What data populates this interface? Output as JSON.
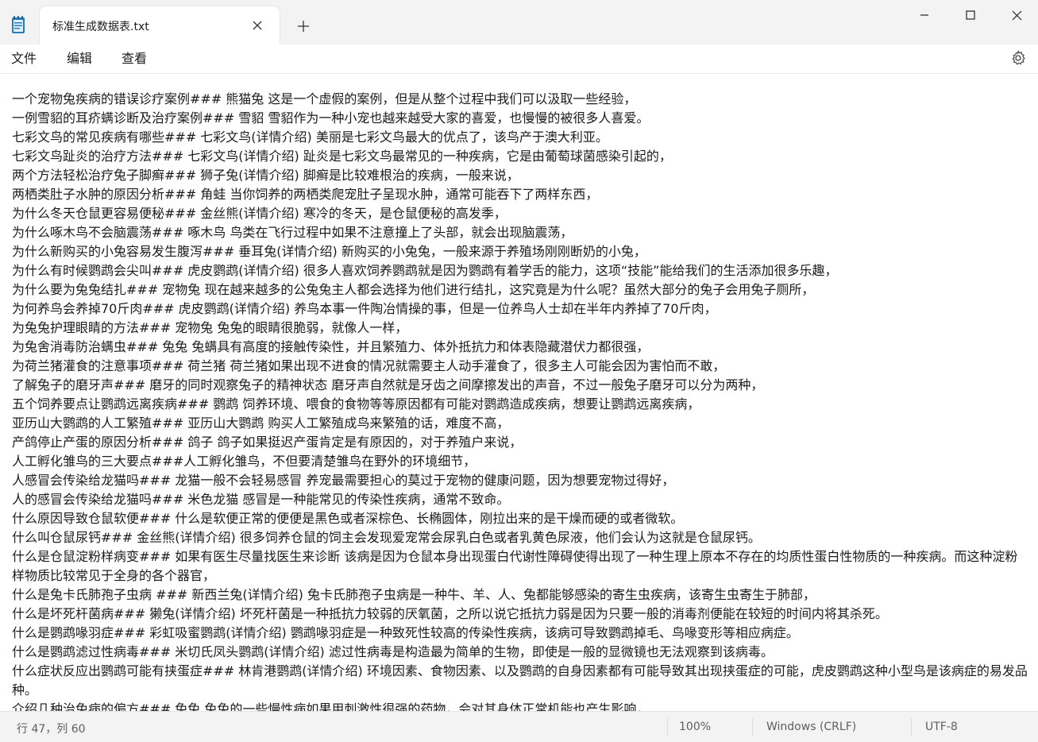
{
  "tab": {
    "title": "标准生成数据表.txt"
  },
  "menu": [
    "文件",
    "编辑",
    "查看"
  ],
  "content": [
    "一个宠物兔疾病的错误诊疗案例### 熊猫兔 这是一个虚假的案例，但是从整个过程中我们可以汲取一些经验，",
    "一例雪貂的耳疥螨诊断及治疗案例### 雪貂 雪貂作为一种小宠也越来越受大家的喜爱，也慢慢的被很多人喜爱。",
    "七彩文鸟的常见疾病有哪些### 七彩文鸟(详情介绍) 美丽是七彩文鸟最大的优点了，该鸟产于澳大利亚。",
    "七彩文鸟趾炎的治疗方法### 七彩文鸟(详情介绍) 趾炎是七彩文鸟最常见的一种疾病，它是由葡萄球菌感染引起的，",
    "两个方法轻松治疗兔子脚癣### 狮子兔(详情介绍) 脚癣是比较难根治的疾病，一般来说，",
    "两栖类肚子水肿的原因分析### 角蛙 当你饲养的两栖类爬宠肚子呈现水肿，通常可能吞下了两样东西，",
    "为什么冬天仓鼠更容易便秘### 金丝熊(详情介绍) 寒冷的冬天，是仓鼠便秘的高发季，",
    "为什么啄木鸟不会脑震荡### 啄木鸟 鸟类在飞行过程中如果不注意撞上了头部，就会出现脑震荡，",
    "为什么新购买的小兔容易发生腹泻### 垂耳兔(详情介绍) 新购买的小兔兔，一般来源于养殖场刚刚断奶的小兔，",
    "为什么有时候鹦鹉会尖叫### 虎皮鹦鹉(详情介绍) 很多人喜欢饲养鹦鹉就是因为鹦鹉有着学舌的能力，这项“技能”能给我们的生活添加很多乐趣，",
    "为什么要为兔兔结扎### 宠物兔 现在越来越多的公兔兔主人都会选择为他们进行结扎，这究竟是为什么呢？虽然大部分的兔子会用兔子厕所，",
    "为何养鸟会养掉70斤肉### 虎皮鹦鹉(详情介绍) 养鸟本事一件陶冶情操的事，但是一位养鸟人士却在半年内养掉了70斤肉，",
    "为兔兔护理眼睛的方法### 宠物兔 兔兔的眼睛很脆弱，就像人一样，",
    "为兔舍消毒防治螨虫### 兔兔 兔螨具有高度的接触传染性，并且繁殖力、体外抵抗力和体表隐藏潜伏力都很强，",
    "为荷兰猪灌食的注意事项### 荷兰猪 荷兰猪如果出现不进食的情况就需要主人动手灌食了，很多主人可能会因为害怕而不敢，",
    "了解兔子的磨牙声### 磨牙的同时观察兔子的精神状态 磨牙声自然就是牙齿之间摩擦发出的声音，不过一般兔子磨牙可以分为两种，",
    "五个饲养要点让鹦鹉远离疾病### 鹦鹉 饲养环境、喂食的食物等等原因都有可能对鹦鹉造成疾病，想要让鹦鹉远离疾病，",
    "亚历山大鹦鹉的人工繁殖### 亚历山大鹦鹉 购买人工繁殖成鸟来繁殖的话，难度不高，",
    "产鸽停止产蛋的原因分析### 鸽子 鸽子如果挺迟产蛋肯定是有原因的，对于养殖户来说，",
    "人工孵化雏鸟的三大要点###人工孵化雏鸟，不但要清楚雏鸟在野外的环境细节，",
    "人感冒会传染给龙猫吗### 龙猫一般不会轻易感冒 养宠最需要担心的莫过于宠物的健康问题，因为想要宠物过得好，",
    "人的感冒会传染给龙猫吗### 米色龙猫 感冒是一种能常见的传染性疾病，通常不致命。",
    "什么原因导致仓鼠软便### 什么是软便正常的便便是黑色或者深棕色、长椭圆体，刚拉出来的是干燥而硬的或者微软。",
    "什么叫仓鼠尿钙### 金丝熊(详情介绍) 很多饲养仓鼠的饲主会发现爱宠常会尿乳白色或者乳黄色尿液，他们会认为这就是仓鼠尿钙。",
    "什么是仓鼠淀粉样病变### 如果有医生尽量找医生来诊断 该病是因为仓鼠本身出现蛋白代谢性障碍使得出现了一种生理上原本不存在的均质性蛋白性物质的一种疾病。而这种淀粉样物质比较常见于全身的各个器官，",
    "什么是兔卡氏肺孢子虫病 ### 新西兰兔(详情介绍) 兔卡氏肺孢子虫病是一种牛、羊、人、兔都能够感染的寄生虫疾病，该寄生虫寄生于肺部，",
    "什么是坏死杆菌病### 獭兔(详情介绍) 坏死杆菌是一种抵抗力较弱的厌氧菌，之所以说它抵抗力弱是因为只要一般的消毒剂便能在较短的时间内将其杀死。",
    "什么是鹦鹉喙羽症### 彩虹吸蜜鹦鹉(详情介绍) 鹦鹉喙羽症是一种致死性较高的传染性疾病，该病可导致鹦鹉掉毛、鸟喙变形等相应病症。",
    "什么是鹦鹉滤过性病毒### 米切氏凤头鹦鹉(详情介绍) 滤过性病毒是构造最为简单的生物，即使是一般的显微镜也无法观察到该病毒。",
    "什么症状反应出鹦鹉可能有挟蛋症### 林肯港鹦鹉(详情介绍) 环境因素、食物因素、以及鹦鹉的自身因素都有可能导致其出现挟蛋症的可能，虎皮鹦鹉这种小型鸟是该病症的易发品种。",
    "介绍几种治兔病的偏方### 兔兔 兔兔的一些慢性病如果用刺激性很强的药物，会对其身体正常机能也产生影响，"
  ],
  "status": {
    "position": "行 47，列 60",
    "zoom": "100%",
    "line_ending": "Windows (CRLF)",
    "encoding": "UTF-8"
  }
}
